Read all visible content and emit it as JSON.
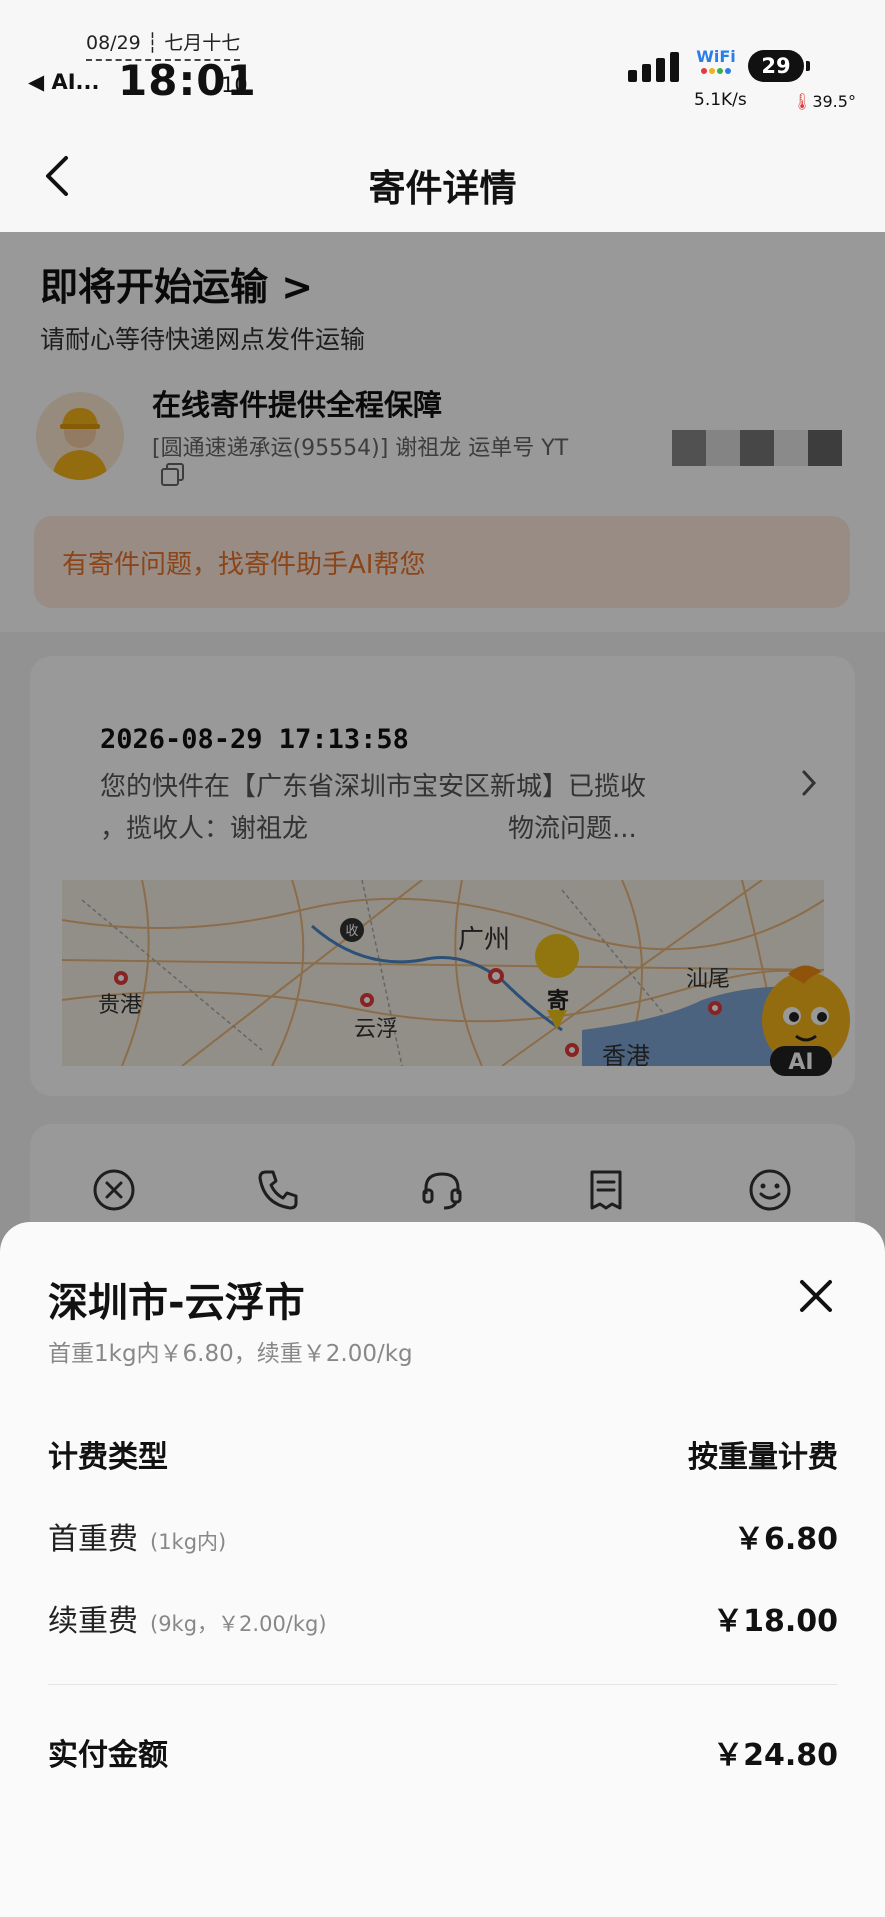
{
  "status_bar": {
    "date": "08/29 ┆ 七月十七",
    "back_app": "◀ AI...",
    "time": "18:01",
    "seconds": ":10",
    "wifi_label": "WiFi",
    "battery": "29",
    "net_speed": "5.1K/s",
    "temperature": "39.5°"
  },
  "nav": {
    "title": "寄件详情"
  },
  "header": {
    "status_title": "即将开始运输 >",
    "status_sub": "请耐心等待快递网点发件运输",
    "guarantee_title": "在线寄件提供全程保障",
    "carrier_info": "[圆通速递承运(95554)] 谢祖龙 运单号 YT",
    "ai_help": "有寄件问题，找寄件助手AI帮您"
  },
  "tracking": {
    "time": "2026-08-29 17:13:58",
    "line1": "您的快件在【广东省深圳市宝安区新城】已揽收",
    "line2": "，揽收人：谢祖龙",
    "line2_right": "物流问题...",
    "map_labels": [
      "广州",
      "贵港",
      "云浮",
      "汕尾",
      "香港"
    ],
    "pin_collect": "收",
    "pin_send": "寄",
    "mascot_label": "AI"
  },
  "actions": [
    "cancel",
    "call",
    "service",
    "bill",
    "rate"
  ],
  "sheet": {
    "route": "深圳市-云浮市",
    "rule": "首重1kg内￥6.80，续重￥2.00/kg",
    "rows": [
      {
        "label": "计费类型",
        "note": "",
        "value": "按重量计费"
      },
      {
        "label": "首重费",
        "note": "(1kg内)",
        "value": "￥6.80"
      },
      {
        "label": "续重费",
        "note": "(9kg，￥2.00/kg)",
        "value": "￥18.00"
      }
    ],
    "total_label": "实付金额",
    "total_value": "￥24.80"
  },
  "colors": {
    "accent_orange": "#e8742a",
    "map_route": "#4a86c8"
  }
}
